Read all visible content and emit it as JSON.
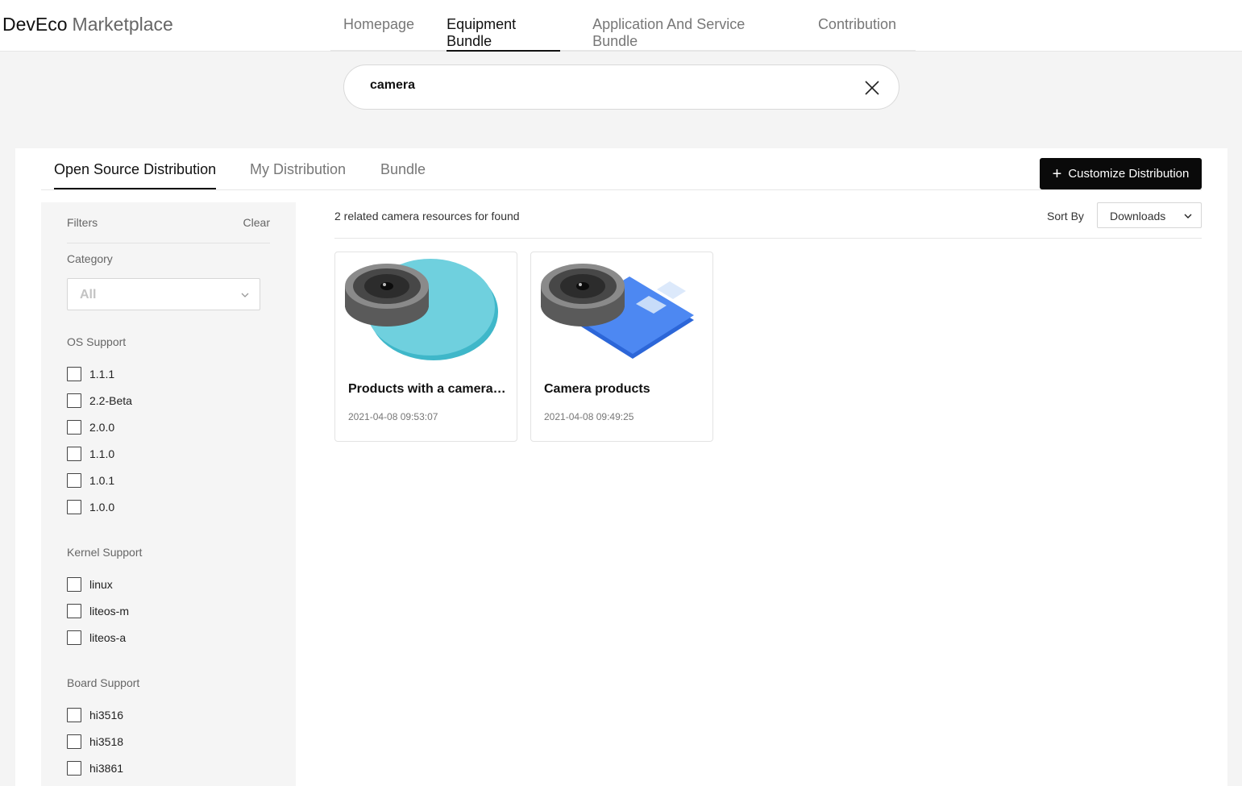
{
  "brand": {
    "primary": "DevEco",
    "secondary": "Marketplace"
  },
  "nav": [
    {
      "label": "Homepage",
      "active": false
    },
    {
      "label": "Equipment Bundle",
      "active": true
    },
    {
      "label": "Application And Service Bundle",
      "active": false
    },
    {
      "label": "Contribution",
      "active": false
    }
  ],
  "search": {
    "value": "camera",
    "clear_icon": "close-icon"
  },
  "tabs": [
    {
      "label": "Open Source Distribution",
      "active": true
    },
    {
      "label": "My Distribution",
      "active": false
    },
    {
      "label": "Bundle",
      "active": false
    }
  ],
  "customize_button": {
    "label": "Customize Distribution",
    "icon": "plus-icon"
  },
  "filters": {
    "title": "Filters",
    "clear_label": "Clear",
    "category": {
      "title": "Category",
      "selected": "All"
    },
    "os_support": {
      "title": "OS Support",
      "options": [
        "1.1.1",
        "2.2-Beta",
        "2.0.0",
        "1.1.0",
        "1.0.1",
        "1.0.0"
      ]
    },
    "kernel_support": {
      "title": "Kernel Support",
      "options": [
        "linux",
        "liteos-m",
        "liteos-a"
      ]
    },
    "board_support": {
      "title": "Board Support",
      "options": [
        "hi3516",
        "hi3518",
        "hi3861"
      ]
    }
  },
  "results": {
    "count_text": "2 related camera resources for found",
    "sort_label": "Sort By",
    "sort_value": "Downloads"
  },
  "cards": [
    {
      "title": "Products with a camera a...",
      "date": "2021-04-08 09:53:07",
      "image": "camera-on-teal-disc"
    },
    {
      "title": "Camera products",
      "date": "2021-04-08 09:49:25",
      "image": "camera-on-blue-tile"
    }
  ],
  "colors": {
    "accent": "#0a0a0a",
    "teal": "#4fc3d4",
    "blue": "#3d7ef0"
  }
}
